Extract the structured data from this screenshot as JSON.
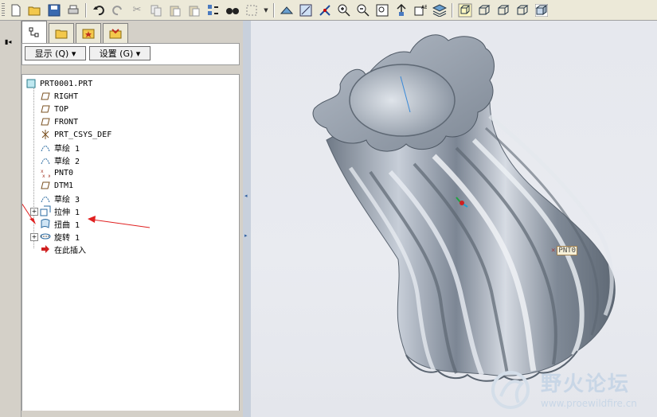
{
  "toolbar": {
    "icons": [
      "new-icon",
      "open-icon",
      "save-icon",
      "print-icon",
      "undo-icon",
      "redo-icon",
      "cut-icon",
      "copy-icon",
      "paste-icon",
      "paste-special-icon",
      "regenerate-icon",
      "find-icon",
      "select-box-icon",
      "spin-center-icon",
      "datum-display-icon",
      "datum-axes-icon",
      "zoom-in-icon",
      "zoom-out-icon",
      "refit-icon",
      "reorient-icon",
      "saved-views-icon",
      "layers-icon",
      "wireframe-icon",
      "hidden-line-icon",
      "no-hidden-icon",
      "shading-icon",
      "shaded-icon"
    ]
  },
  "panel": {
    "tabs": [
      "model-tree-tab",
      "folder-browser-tab",
      "favorites-tab",
      "connections-tab"
    ],
    "show_label": "显示 (Q) ▾",
    "settings_label": "设置 (G) ▾"
  },
  "tree": {
    "root": "PRT0001.PRT",
    "items": [
      {
        "label": "RIGHT",
        "icon": "datum-plane-icon"
      },
      {
        "label": "TOP",
        "icon": "datum-plane-icon"
      },
      {
        "label": "FRONT",
        "icon": "datum-plane-icon"
      },
      {
        "label": "PRT_CSYS_DEF",
        "icon": "csys-icon"
      },
      {
        "label": "草绘 1",
        "icon": "sketch-icon"
      },
      {
        "label": "草绘 2",
        "icon": "sketch-icon"
      },
      {
        "label": "PNT0",
        "icon": "datum-point-icon"
      },
      {
        "label": "DTM1",
        "icon": "datum-plane-icon"
      },
      {
        "label": "草绘 3",
        "icon": "sketch-icon"
      },
      {
        "label": "拉伸 1",
        "icon": "extrude-icon"
      },
      {
        "label": "扭曲 1",
        "icon": "warp-icon"
      },
      {
        "label": "旋转 1",
        "icon": "revolve-icon"
      },
      {
        "label": "在此插入",
        "icon": "insert-here-icon"
      }
    ]
  },
  "viewport": {
    "point_label": "PNT0",
    "watermark_title": "野火论坛",
    "watermark_url": "www.proewildfire.cn"
  },
  "colors": {
    "annotation_arrow": "#e02020",
    "model_surface": "#8e98a6",
    "watermark": "#c8d6e6"
  }
}
